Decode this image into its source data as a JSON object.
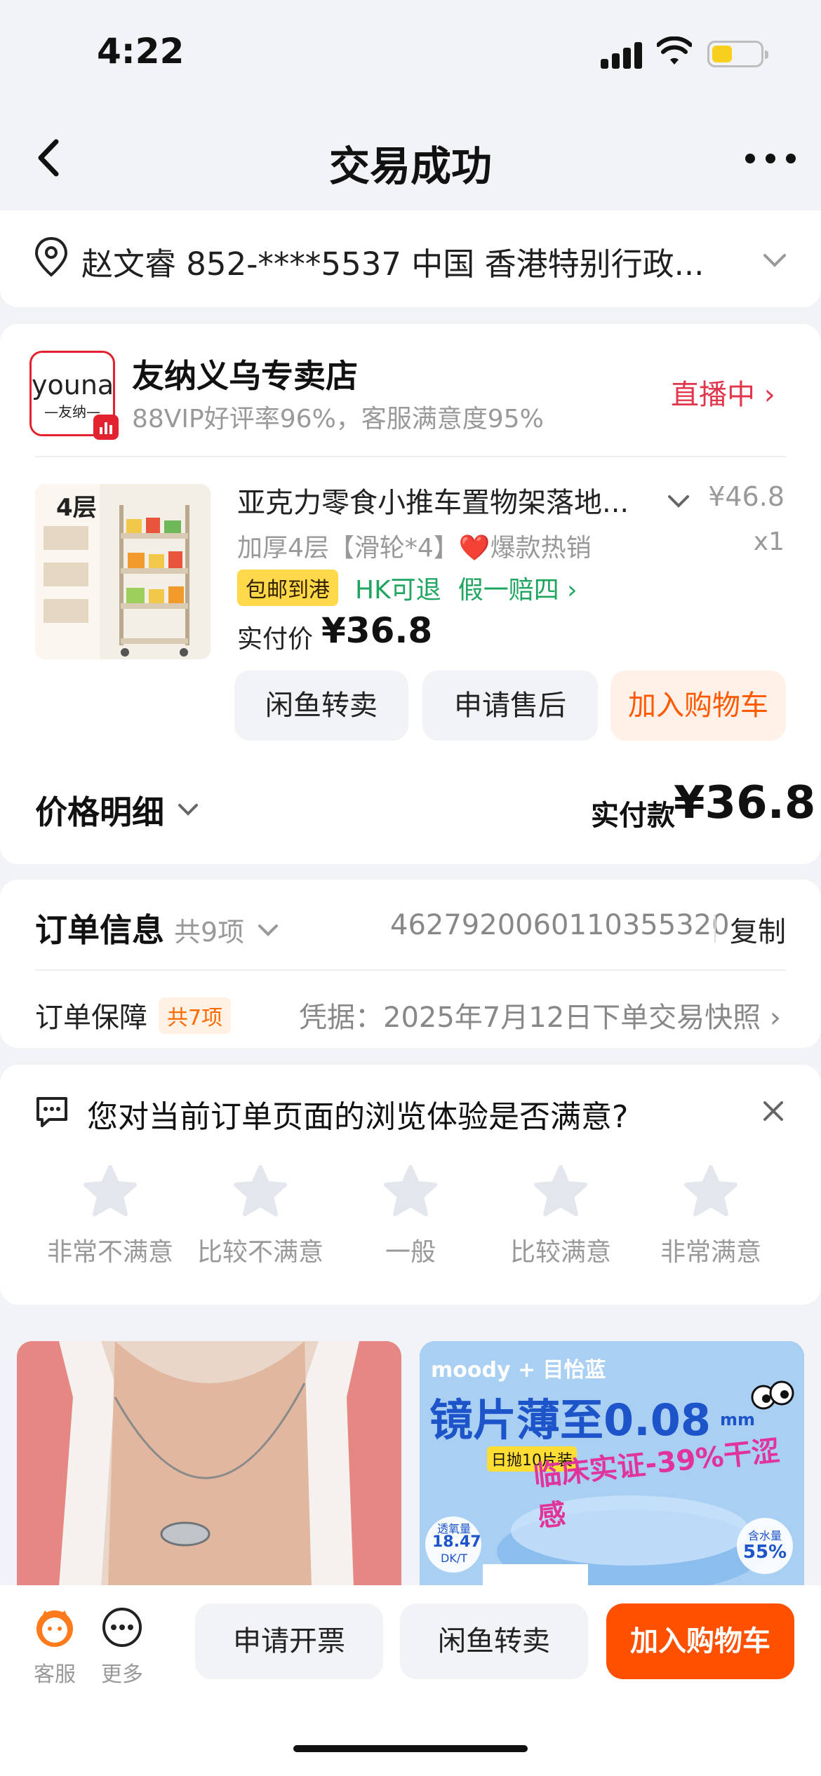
{
  "status_bar": {
    "time": "4:22"
  },
  "nav": {
    "title": "交易成功"
  },
  "address": {
    "text": "赵文睿 852-****5537 中国 香港特别行政..."
  },
  "store": {
    "logo_en": "youna",
    "logo_cn": "—友纳—",
    "name": "友纳义乌专卖店",
    "rating": "88VIP好评率96%，客服满意度95%",
    "live_label": "直播中 ›"
  },
  "product": {
    "image_text": "4层",
    "title": "亚克力零食小推车置物架落地...",
    "price": "¥46.8",
    "sku": "加厚4层【滑轮*4】❤️爆款热销",
    "quantity": "x1",
    "tags": {
      "shipping": "包邮到港",
      "hk_return": "HK可退",
      "fake_compensation": "假一赔四 ›"
    },
    "actual_label": "实付价",
    "actual_price": "¥36.8",
    "buttons": {
      "resell": "闲鱼转卖",
      "after_sale": "申请售后",
      "add_cart": "加入购物车"
    }
  },
  "price_detail": {
    "label": "价格明细",
    "total_label": "实付款",
    "total_value": "¥36.8"
  },
  "order": {
    "info_label": "订单信息",
    "info_count": "共9项",
    "number": "4627920060110355320",
    "copy_label": "复制",
    "guarantee_label": "订单保障",
    "guarantee_badge": "共7项",
    "guarantee_text": "凭据：2025年7月12日下单交易快照 ›"
  },
  "survey": {
    "question": "您对当前订单页面的浏览体验是否满意?",
    "ratings": [
      "非常不满意",
      "比较不满意",
      "一般",
      "比较满意",
      "非常满意"
    ]
  },
  "recommendations": {
    "lens_brand": "moody + 目怡蓝",
    "lens_headline": "镜片薄至0.08",
    "lens_unit": "mm",
    "lens_badge": "日抛10片装",
    "lens_claim": "临床实证-39%干涩感",
    "lens_oxygen_label": "透氧量",
    "lens_oxygen_value": "18.47",
    "lens_oxygen_unit": "DK/T",
    "lens_water_label": "含水量",
    "lens_water_value": "55%"
  },
  "bottom_bar": {
    "customer_service": "客服",
    "more": "更多",
    "invoice": "申请开票",
    "resell": "闲鱼转卖",
    "add_cart": "加入购物车"
  },
  "colors": {
    "accent_orange": "#ff5000",
    "live_red": "#e0374d",
    "guarantee_green": "#1ea55f",
    "tag_yellow": "#ffd94a"
  }
}
